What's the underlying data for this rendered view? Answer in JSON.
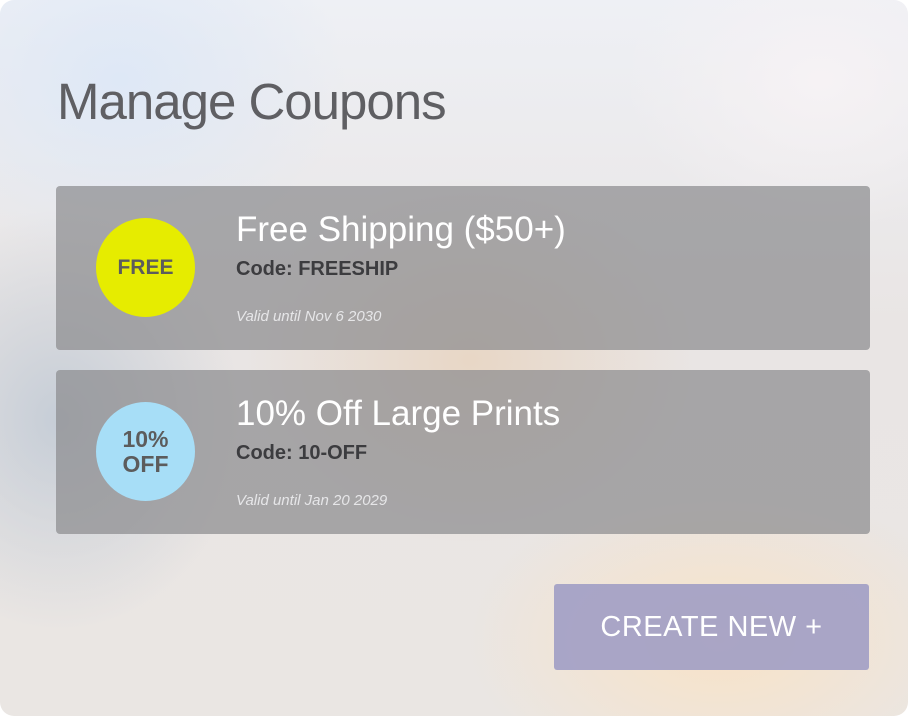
{
  "page": {
    "title": "Manage Coupons"
  },
  "coupons": [
    {
      "badge_lines": [
        "FREE"
      ],
      "badge_color": "#e6ec00",
      "title": "Free Shipping ($50+)",
      "code": "Code: FREESHIP",
      "valid": "Valid until Nov 6 2030"
    },
    {
      "badge_lines": [
        "10%",
        "OFF"
      ],
      "badge_color": "#a7def7",
      "title": "10% Off Large Prints",
      "code": "Code: 10-OFF",
      "valid": "Valid until Jan 20 2029"
    }
  ],
  "actions": {
    "create_label": "CREATE NEW +",
    "create_color": "#9e9cc4"
  }
}
